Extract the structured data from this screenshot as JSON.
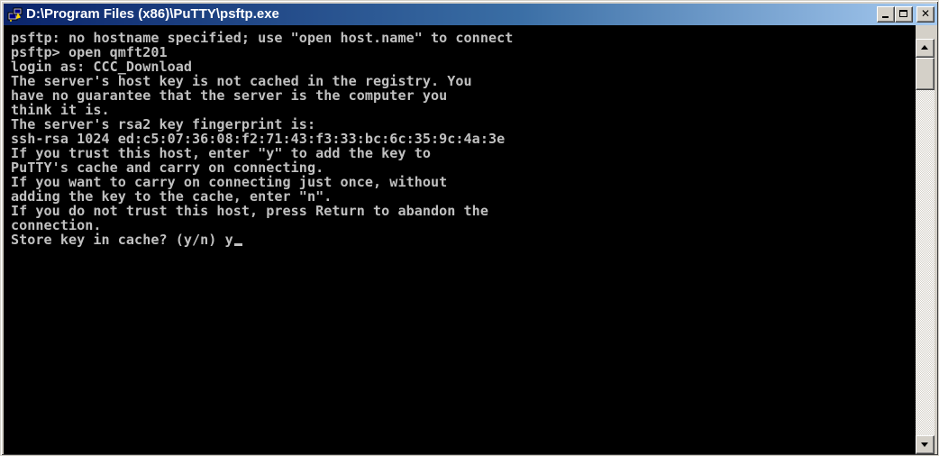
{
  "window": {
    "title": "D:\\Program Files (x86)\\PuTTY\\psftp.exe",
    "icon": "putty-icon",
    "caption_buttons": [
      "minimize-icon",
      "maximize-icon",
      "close-icon"
    ],
    "close_glyph": "✕"
  },
  "terminal": {
    "background": "#000000",
    "foreground": "#c0c0c0",
    "lines": [
      "psftp: no hostname specified; use \"open host.name\" to connect",
      "psftp> open qmft201",
      "login as: CCC_Download",
      "The server's host key is not cached in the registry. You",
      "have no guarantee that the server is the computer you",
      "think it is.",
      "The server's rsa2 key fingerprint is:",
      "ssh-rsa 1024 ed:c5:07:36:08:f2:71:43:f3:33:bc:6c:35:9c:4a:3e",
      "If you trust this host, enter \"y\" to add the key to",
      "PuTTY's cache and carry on connecting.",
      "If you want to carry on connecting just once, without",
      "adding the key to the cache, enter \"n\".",
      "If you do not trust this host, press Return to abandon the",
      "connection.",
      "Store key in cache? (y/n) y"
    ]
  },
  "scrollbar": {
    "position_fraction": 0.0
  }
}
